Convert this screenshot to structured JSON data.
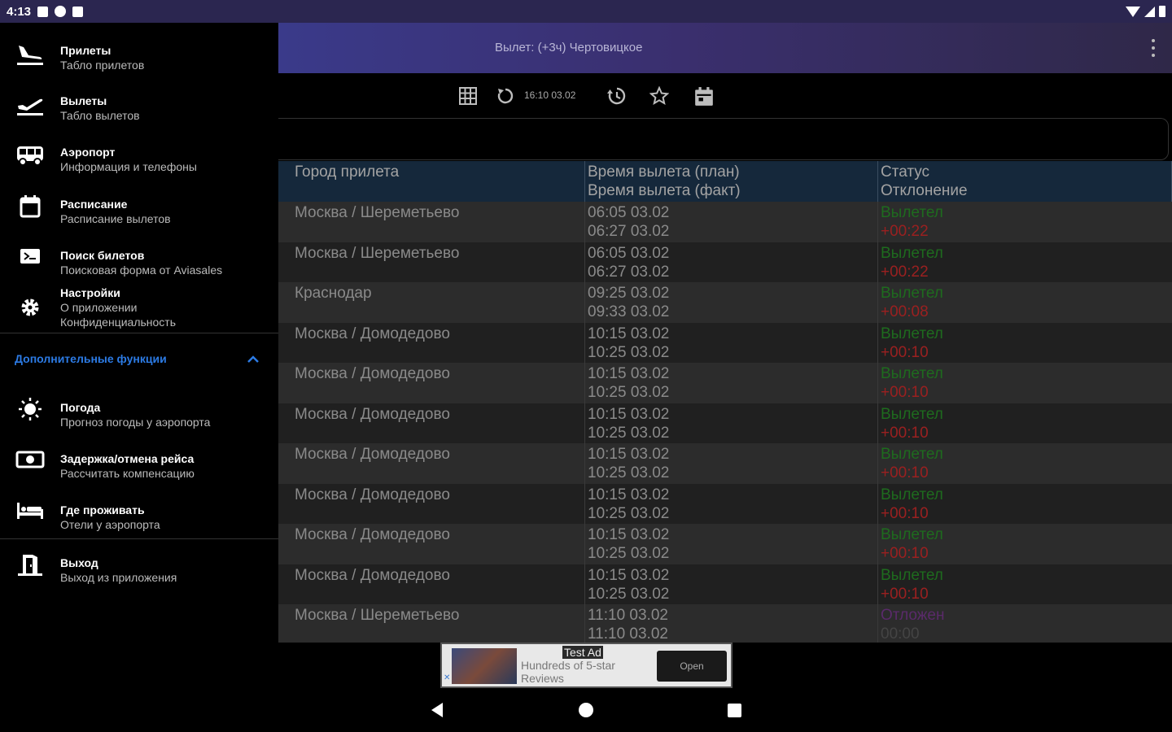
{
  "status_bar": {
    "time": "4:13"
  },
  "app_bar": {
    "title": "Вылет: (+3ч) Чертовицкое"
  },
  "toolbar": {
    "time_label": "16:10 03.02"
  },
  "drawer": {
    "items": [
      {
        "title": "Прилеты",
        "subtitle": "Табло прилетов",
        "icon": "plane-landing-icon"
      },
      {
        "title": "Вылеты",
        "subtitle": "Табло вылетов",
        "icon": "plane-takeoff-icon"
      },
      {
        "title": "Аэропорт",
        "subtitle": "Информация и телефоны",
        "icon": "bus-icon"
      },
      {
        "title": "Расписание",
        "subtitle": "Расписание вылетов",
        "icon": "calendar-icon"
      },
      {
        "title": "Поиск билетов",
        "subtitle": "Поисковая форма от Aviasales",
        "icon": "ticket-icon"
      },
      {
        "title": "Настройки",
        "subtitle": "О приложении",
        "subtitle2": "Конфиденциальность",
        "icon": "gear-icon"
      }
    ],
    "section_label": "Дополнительные функции",
    "extra_items": [
      {
        "title": "Погода",
        "subtitle": "Прогноз погоды у аэропорта",
        "icon": "sun-icon"
      },
      {
        "title": "Задержка/отмена рейса",
        "subtitle": "Рассчитать компенсацию",
        "icon": "money-icon"
      },
      {
        "title": "Где проживать",
        "subtitle": "Отели у аэропорта",
        "icon": "bed-icon"
      }
    ],
    "exit_item": {
      "title": "Выход",
      "subtitle": "Выход из приложения",
      "icon": "exit-icon"
    }
  },
  "table": {
    "headers": {
      "city": "Город прилета",
      "time_plan": "Время вылета (план)",
      "time_fact": "Время вылета (факт)",
      "status": "Статус",
      "deviation": "Отклонение"
    },
    "rows": [
      {
        "city": "Москва / Шереметьево",
        "plan": "06:05 03.02",
        "fact": "06:27 03.02",
        "status": "Вылетел",
        "deviation": "+00:22"
      },
      {
        "city": "Москва / Шереметьево",
        "plan": "06:05 03.02",
        "fact": "06:27 03.02",
        "status": "Вылетел",
        "deviation": "+00:22"
      },
      {
        "city": "Краснодар",
        "plan": "09:25 03.02",
        "fact": "09:33 03.02",
        "status": "Вылетел",
        "deviation": "+00:08"
      },
      {
        "city": "Москва / Домодедово",
        "plan": "10:15 03.02",
        "fact": "10:25 03.02",
        "status": "Вылетел",
        "deviation": "+00:10"
      },
      {
        "city": "Москва / Домодедово",
        "plan": "10:15 03.02",
        "fact": "10:25 03.02",
        "status": "Вылетел",
        "deviation": "+00:10"
      },
      {
        "city": "Москва / Домодедово",
        "plan": "10:15 03.02",
        "fact": "10:25 03.02",
        "status": "Вылетел",
        "deviation": "+00:10"
      },
      {
        "city": "Москва / Домодедово",
        "plan": "10:15 03.02",
        "fact": "10:25 03.02",
        "status": "Вылетел",
        "deviation": "+00:10"
      },
      {
        "city": "Москва / Домодедово",
        "plan": "10:15 03.02",
        "fact": "10:25 03.02",
        "status": "Вылетел",
        "deviation": "+00:10"
      },
      {
        "city": "Москва / Домодедово",
        "plan": "10:15 03.02",
        "fact": "10:25 03.02",
        "status": "Вылетел",
        "deviation": "+00:10"
      },
      {
        "city": "Москва / Домодедово",
        "plan": "10:15 03.02",
        "fact": "10:25 03.02",
        "status": "Вылетел",
        "deviation": "+00:10"
      },
      {
        "city": "Москва / Шереметьево",
        "plan": "11:10 03.02",
        "fact": "11:10 03.02",
        "status": "Отложен",
        "deviation": "00:00"
      }
    ]
  },
  "ad": {
    "label": "Test Ad",
    "text": "Hundreds of 5-star Reviews",
    "button": "Open"
  },
  "colors": {
    "status_departed": "#1e6b1e",
    "deviation_late": "#9a2020",
    "status_delayed": "#5a2a6a",
    "section_accent": "#2c7be5"
  }
}
